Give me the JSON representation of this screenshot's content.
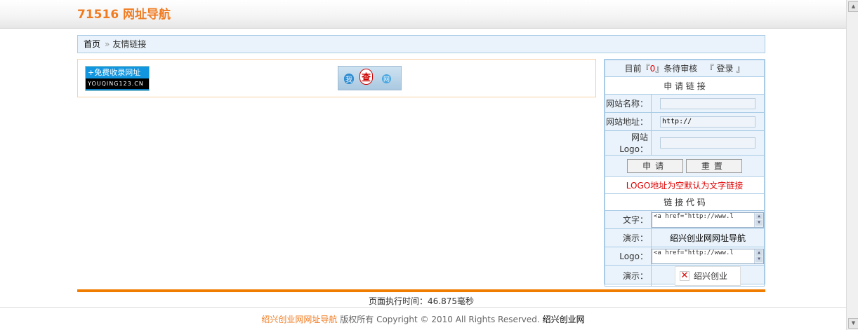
{
  "header": {
    "site_title": "71516 网址导航"
  },
  "breadcrumb": {
    "home": "首页",
    "separator": "»",
    "current": "友情链接"
  },
  "links": {
    "logo1_line1": "+免费收录网址",
    "logo1_line2": "YOUQING123.CN",
    "logo2_parts": [
      "我",
      "查",
      "网"
    ]
  },
  "sidebar": {
    "pending_prefix": "目前『",
    "pending_count": "0",
    "pending_suffix": "』条待审核",
    "login": "『 登录 』",
    "apply_title": "申 请 链 接",
    "site_name_label": "网站名称：",
    "site_url_label": "网站地址：",
    "site_url_value": "http://",
    "site_logo_label": "网站Logo：",
    "apply_button": "申请",
    "reset_button": "重置",
    "note": "LOGO地址为空默认为文字链接",
    "code_title": "链 接 代 码",
    "text_label": "文字：",
    "text_code": "<a href=\"http://www.l",
    "demo_label": "演示：",
    "demo_text": "绍兴创业网网址导航",
    "logo_label": "Logo：",
    "logo_code": "<a href=\"http://www.l",
    "demo_label2": "演示：",
    "demo_logo_text": "绍兴创业"
  },
  "footer": {
    "exec_time": "页面执行时间：46.875毫秒",
    "brand": "绍兴创业网网址导航",
    "rights": "版权所有  Copyright © 2010 All Rights Reserved.",
    "site": "绍兴创业网"
  }
}
